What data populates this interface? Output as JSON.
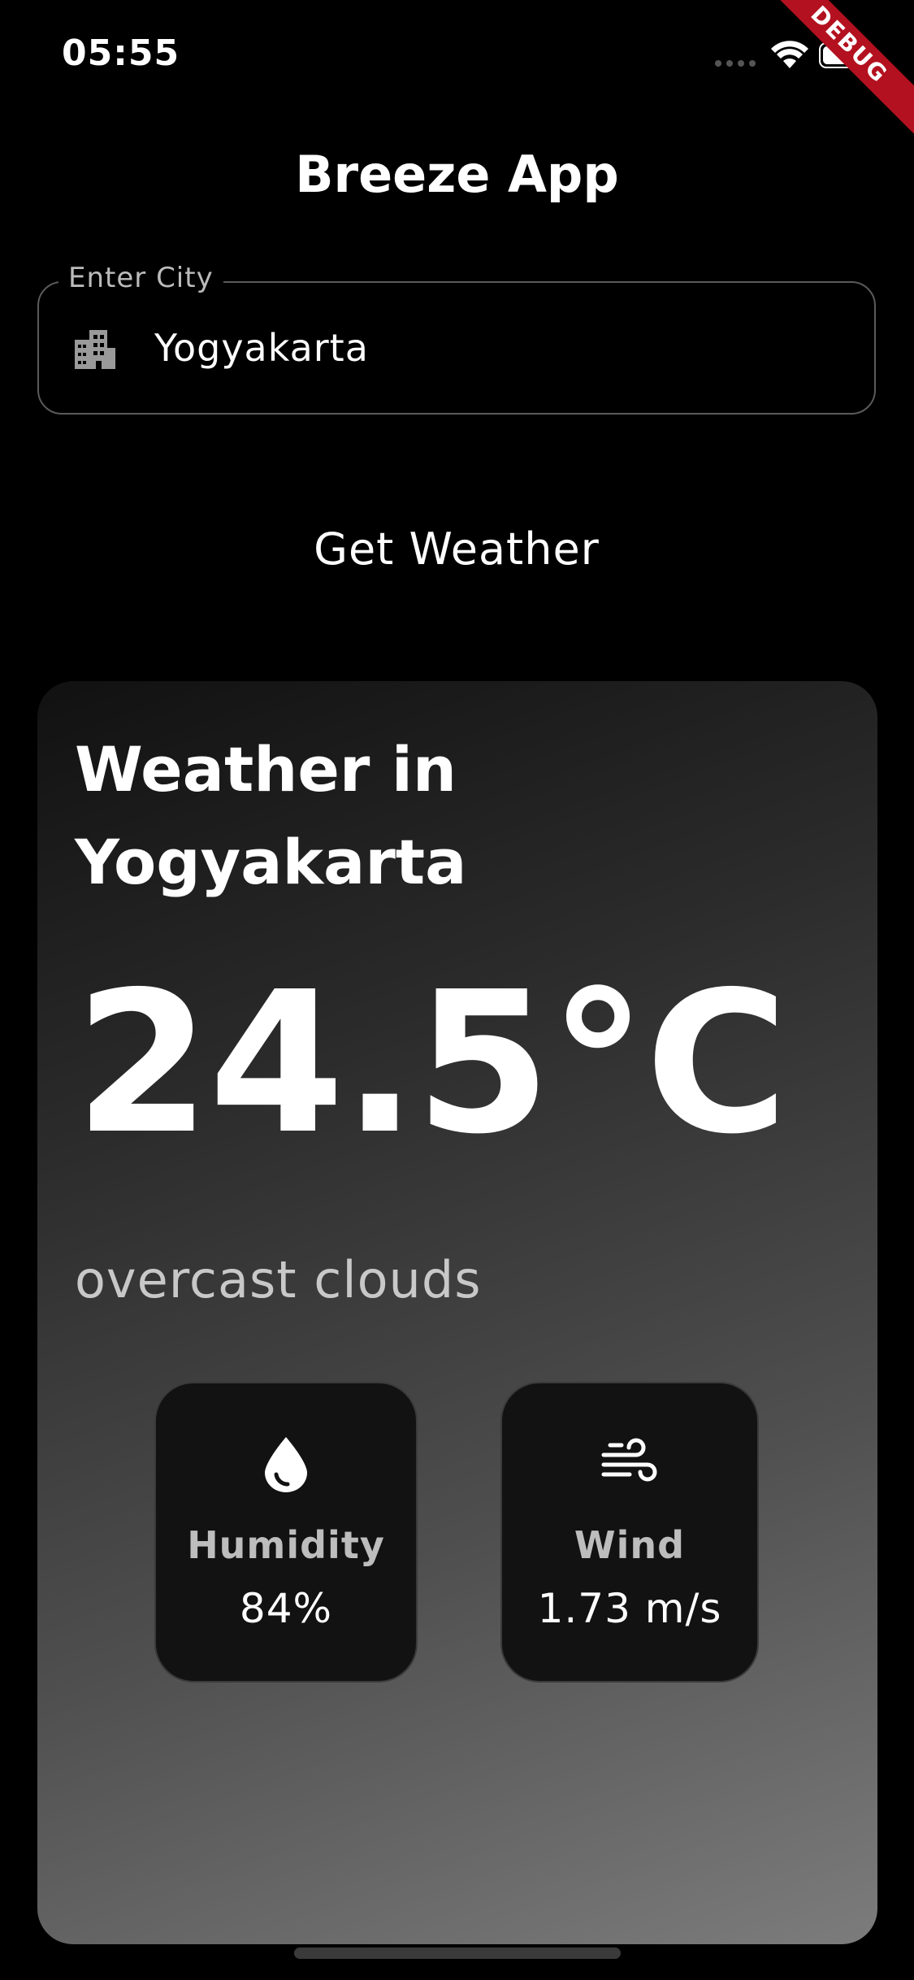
{
  "status_bar": {
    "time": "05:55",
    "debug_label": "DEBUG"
  },
  "app": {
    "title": "Breeze App"
  },
  "city_input": {
    "label": "Enter City",
    "value": "Yogyakarta",
    "icon": "building-icon"
  },
  "get_weather_button": {
    "label": "Get Weather"
  },
  "weather": {
    "title": "Weather in Yogyakarta",
    "temperature": "24.5°C",
    "description": "overcast clouds",
    "humidity": {
      "label": "Humidity",
      "value": "84%",
      "icon": "water-drop-icon"
    },
    "wind": {
      "label": "Wind",
      "value": "1.73 m/s",
      "icon": "wind-icon"
    }
  },
  "colors": {
    "background": "#000000",
    "debug_banner": "#b3111f",
    "card_gradient_start": "#111111",
    "card_gradient_end": "#7c7c7c",
    "stat_card": "#121212"
  }
}
